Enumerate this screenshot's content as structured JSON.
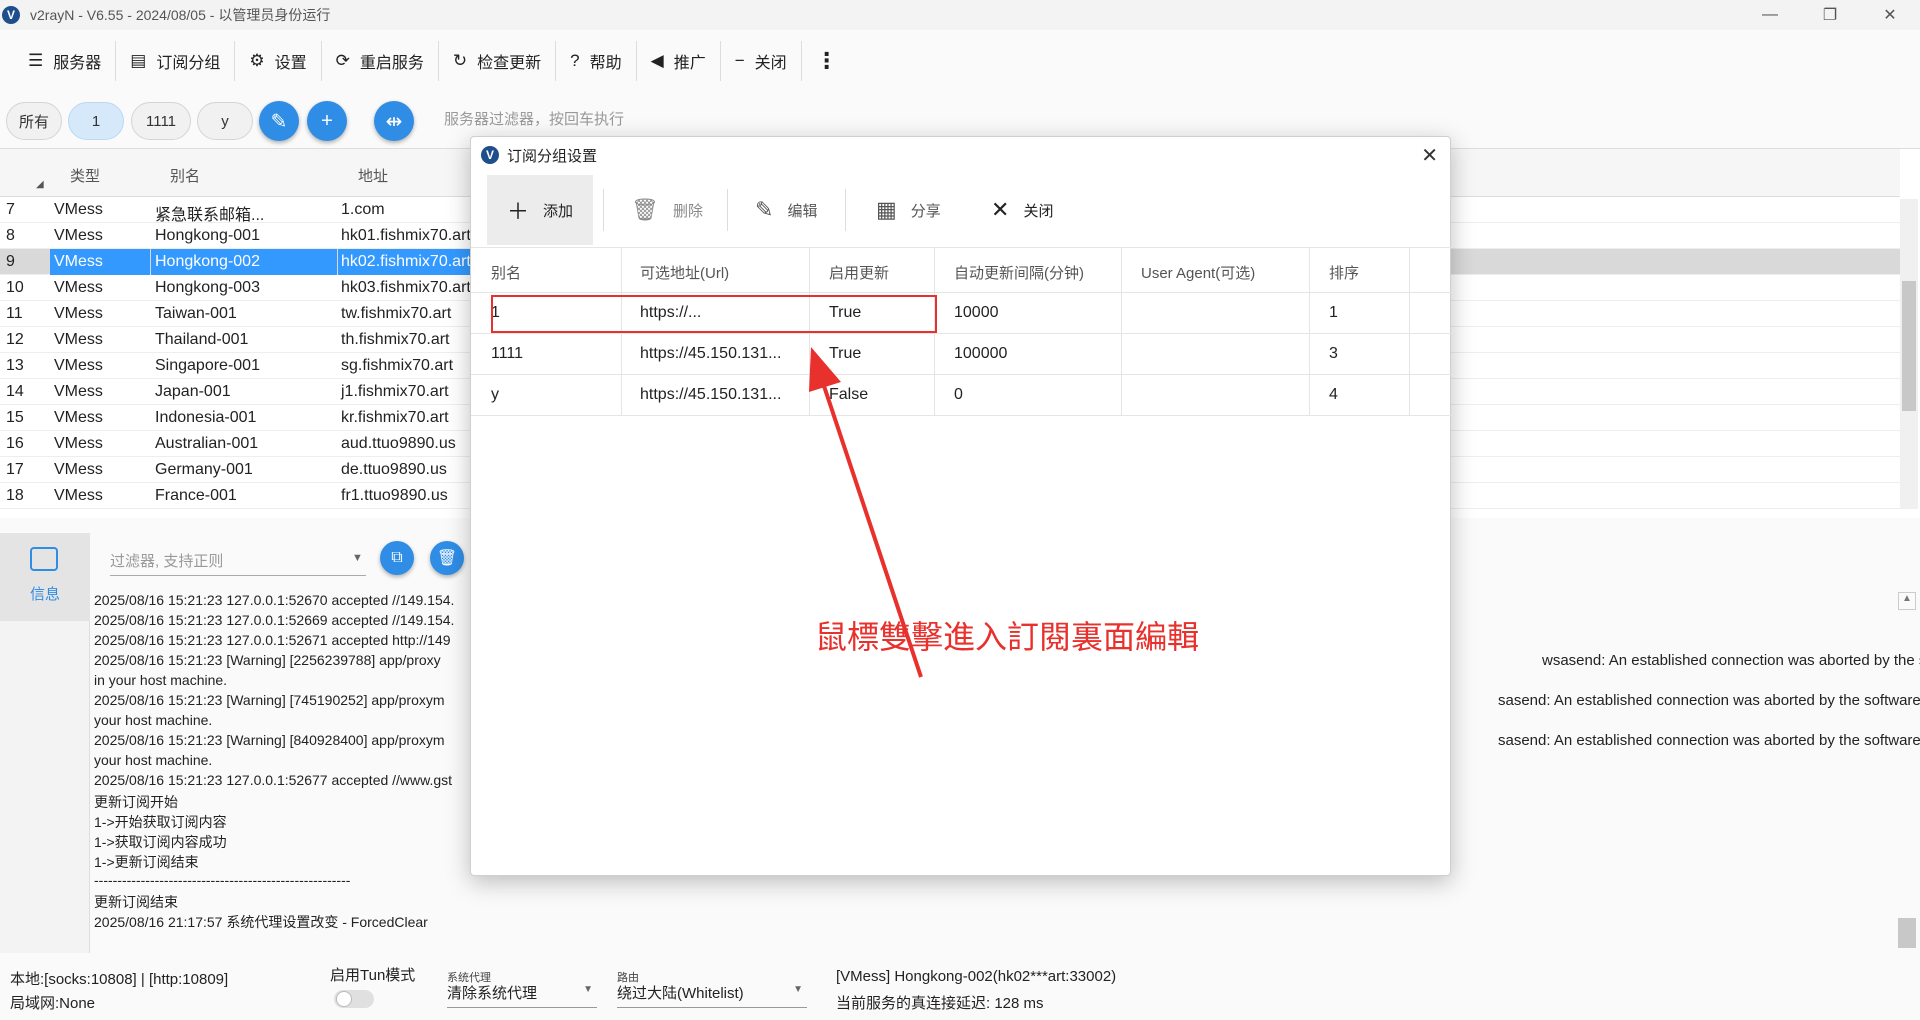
{
  "window": {
    "title": "v2rayN - V6.55 - 2024/08/05 - 以管理员身份运行",
    "logo": "V"
  },
  "toolbar": [
    {
      "icon": "server-icon",
      "glyph": "☰",
      "label": "服务器"
    },
    {
      "icon": "subscription-icon",
      "glyph": "▤",
      "label": "订阅分组"
    },
    {
      "icon": "gear-icon",
      "glyph": "⚙",
      "label": "设置"
    },
    {
      "icon": "restart-icon",
      "glyph": "⟳",
      "label": "重启服务"
    },
    {
      "icon": "update-icon",
      "glyph": "↻",
      "label": "检查更新"
    },
    {
      "icon": "help-icon",
      "glyph": "?",
      "label": "帮助"
    },
    {
      "icon": "promote-icon",
      "glyph": "◀",
      "label": "推广"
    },
    {
      "icon": "minus-icon",
      "glyph": "−",
      "label": "关闭"
    }
  ],
  "filter_chips": [
    "所有",
    "1",
    "1111",
    "y"
  ],
  "filter_placeholder": "服务器过滤器，按回车执行",
  "server_table": {
    "headers": [
      "类型",
      "别名",
      "地址"
    ],
    "rows": [
      {
        "no": "7",
        "type": "VMess",
        "alias": "紧急联系邮箱...",
        "addr": "1.com"
      },
      {
        "no": "8",
        "type": "VMess",
        "alias": "Hongkong-001",
        "addr": "hk01.fishmix70.art"
      },
      {
        "no": "9",
        "type": "VMess",
        "alias": "Hongkong-002",
        "addr": "hk02.fishmix70.art",
        "selected": true
      },
      {
        "no": "10",
        "type": "VMess",
        "alias": "Hongkong-003",
        "addr": "hk03.fishmix70.art"
      },
      {
        "no": "11",
        "type": "VMess",
        "alias": "Taiwan-001",
        "addr": "tw.fishmix70.art"
      },
      {
        "no": "12",
        "type": "VMess",
        "alias": "Thailand-001",
        "addr": "th.fishmix70.art"
      },
      {
        "no": "13",
        "type": "VMess",
        "alias": "Singapore-001",
        "addr": "sg.fishmix70.art"
      },
      {
        "no": "14",
        "type": "VMess",
        "alias": "Japan-001",
        "addr": "j1.fishmix70.art"
      },
      {
        "no": "15",
        "type": "VMess",
        "alias": "Indonesia-001",
        "addr": "kr.fishmix70.art"
      },
      {
        "no": "16",
        "type": "VMess",
        "alias": "Australian-001",
        "addr": "aud.ttuo9890.us"
      },
      {
        "no": "17",
        "type": "VMess",
        "alias": "Germany-001",
        "addr": "de.ttuo9890.us"
      },
      {
        "no": "18",
        "type": "VMess",
        "alias": "France-001",
        "addr": "fr1.ttuo9890.us"
      }
    ]
  },
  "log": {
    "tab_label": "信息",
    "filter_placeholder": "过滤器, 支持正则",
    "lines": [
      "2025/08/16 15:21:23 127.0.0.1:52670 accepted //149.154.",
      "2025/08/16 15:21:23 127.0.0.1:52669 accepted //149.154.",
      "2025/08/16 15:21:23 127.0.0.1:52671 accepted http://149",
      "2025/08/16 15:21:23 [Warning] [2256239788] app/proxy",
      "in your host machine.",
      "2025/08/16 15:21:23 [Warning] [745190252] app/proxym",
      "your host machine.",
      "2025/08/16 15:21:23 [Warning] [840928400] app/proxym",
      "your host machine.",
      "2025/08/16 15:21:23 127.0.0.1:52677 accepted //www.gst",
      "更新订阅开始",
      "1->开始获取订阅内容",
      "1->获取订阅内容成功",
      "1->更新订阅结束",
      "-------------------------------------------------------",
      "更新订阅结束",
      "2025/08/16 21:17:57 系统代理设置改变 - ForcedClear"
    ],
    "right_fragments": [
      "wsasend: An established connection was aborted by the software",
      "sasend: An established connection was aborted by the software in",
      "sasend: An established connection was aborted by the software in"
    ]
  },
  "status": {
    "local": "本地:[socks:10808] | [http:10809]",
    "lan": "局域网:None",
    "tun_label": "启用Tun模式",
    "sysproxy_label": "系统代理",
    "sysproxy_value": "清除系统代理",
    "route_label": "路由",
    "route_value": "绕过大陆(Whitelist)",
    "current_server": "[VMess] Hongkong-002(hk02***art:33002)",
    "latency": "当前服务的真连接延迟: 128 ms"
  },
  "dialog": {
    "title": "订阅分组设置",
    "buttons": {
      "add": "添加",
      "delete": "删除",
      "edit": "编辑",
      "share": "分享",
      "close": "关闭"
    },
    "headers": [
      "别名",
      "可选地址(Url)",
      "启用更新",
      "自动更新间隔(分钟)",
      "User Agent(可选)",
      "排序"
    ],
    "rows": [
      {
        "alias": "1",
        "url": "https://...",
        "enabled": "True",
        "interval": "10000",
        "ua": "",
        "sort": "1"
      },
      {
        "alias": "1111",
        "url": "https://45.150.131...",
        "enabled": "True",
        "interval": "100000",
        "ua": "",
        "sort": "3"
      },
      {
        "alias": "y",
        "url": "https://45.150.131...",
        "enabled": "False",
        "interval": "0",
        "ua": "",
        "sort": "4"
      }
    ]
  },
  "annotation": "鼠標雙擊進入訂閱裏面編輯",
  "colors": {
    "accent": "#2f8de6",
    "selection": "#3399ff",
    "annotation": "#e8302c"
  }
}
